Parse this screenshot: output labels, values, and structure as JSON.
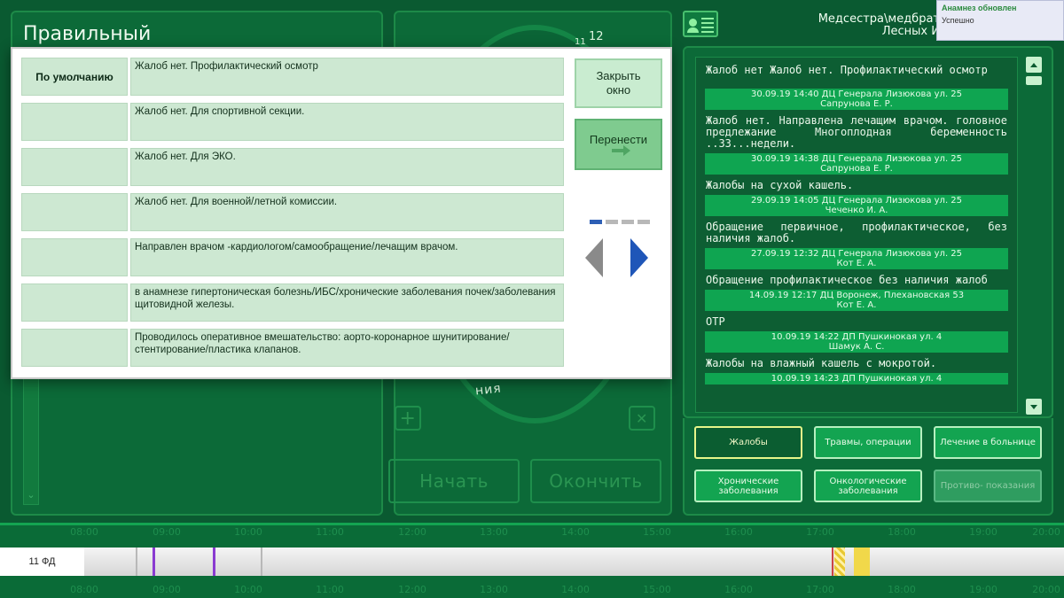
{
  "title": "Правильный",
  "header": {
    "role": "Медсестра\\медбрат",
    "location": "Лесных И"
  },
  "clock": {
    "n12": "12",
    "n11": "11"
  },
  "dial_partial": "ния",
  "toast": {
    "title": "Анамнез обновлен",
    "status": "Успешно"
  },
  "buttons": {
    "start": "Начать",
    "finish": "Окончить",
    "plus": "+",
    "close_x": "✕"
  },
  "modal": {
    "close_label": "Закрыть окно",
    "transfer_label": "Перенести",
    "default_label": "По умолчанию",
    "rows": [
      "Жалоб нет. Профилактический осмотр",
      "Жалоб нет. Для спортивной секции.",
      "Жалоб нет. Для ЭКО.",
      "Жалоб нет. Для военной/летной комиссии.",
      "Направлен врачом -кардиологом/самообращение/лечащим врачом.",
      "в анамнезе гипертоническая болезнь/ИБС/хронические заболевания почек/заболевания щитовидной железы.",
      "Проводилось оперативное вмешательство: аорто-коронарное шунитирование/ стентирование/пластика клапанов."
    ],
    "page_indicator": {
      "current": 1,
      "total": 4
    }
  },
  "history": [
    {
      "text": "Жалоб нет Жалоб нет. Профилактический осмотр",
      "meta1": "30.09.19 14:40 ДЦ Генерала Лизюкова ул. 25",
      "meta2": "Сапрунова Е. Р."
    },
    {
      "text": "Жалоб нет. Направлена лечащим врачом. головное предлежание Многоплодная беременность ..33...недели.",
      "meta1": "30.09.19 14:38 ДЦ Генерала Лизюкова ул. 25",
      "meta2": "Сапрунова Е. Р."
    },
    {
      "text": "Жалобы на сухой кашель.",
      "meta1": "29.09.19 14:05 ДЦ Генерала Лизюкова ул. 25",
      "meta2": "Чеченко И. А."
    },
    {
      "text": "Обращение первичное, профилактическое, без наличия жалоб.",
      "meta1": "27.09.19 12:32 ДЦ Генерала Лизюкова ул. 25",
      "meta2": "Кот Е. А."
    },
    {
      "text": "Обращение профилактическое без наличия жалоб",
      "meta1": "14.09.19 12:17 ДЦ Воронеж, Плехановская 53",
      "meta2": "Кот Е. А."
    },
    {
      "text": "ОТР",
      "meta1": "10.09.19 14:22 ДП Пушкинокая ул. 4",
      "meta2": "Шамук А. С."
    },
    {
      "text": "Жалобы на влажный кашель с мокротой.",
      "meta1": "10.09.19 14:23 ДП Пушкинокая ул. 4",
      "meta2": ""
    }
  ],
  "categories": [
    {
      "label": "Жалобы",
      "state": "active"
    },
    {
      "label": "Травмы, операции",
      "state": "normal"
    },
    {
      "label": "Лечение в больнице",
      "state": "normal"
    },
    {
      "label": "Хронические заболевания",
      "state": "normal"
    },
    {
      "label": "Онкологические заболевания",
      "state": "normal"
    },
    {
      "label": "Противо- показания",
      "state": "disabled"
    }
  ],
  "timeline": {
    "room_label": "11 ФД",
    "hours": [
      "08:00",
      "09:00",
      "10:00",
      "11:00",
      "12:00",
      "13:00",
      "14:00",
      "15:00",
      "16:00",
      "17:00",
      "18:00",
      "19:00",
      "20:00"
    ]
  },
  "colors": {
    "background": "#0a5a31",
    "accent": "#13a451",
    "active_border": "#e6f58a",
    "timeline_purple": "#8a3bd1",
    "timeline_yellow": "#f1d84a"
  }
}
